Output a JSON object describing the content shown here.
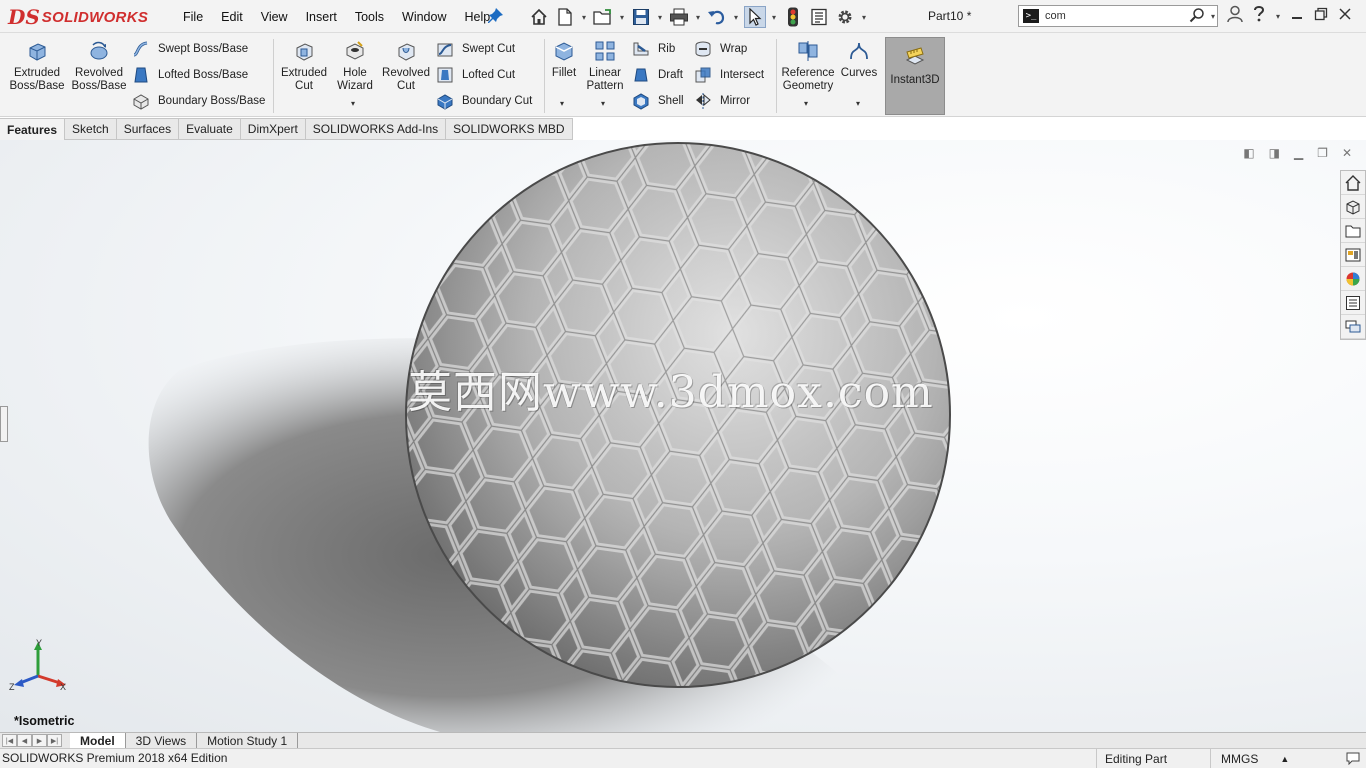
{
  "app": {
    "brand_mark": "DS",
    "brand_name": "SOLIDWORKS",
    "doc_title": "Part10 *"
  },
  "menu": [
    "File",
    "Edit",
    "View",
    "Insert",
    "Tools",
    "Window",
    "Help"
  ],
  "search": {
    "value": "com"
  },
  "commands": {
    "extruded_boss": "Extruded\nBoss/Base",
    "revolved_boss": "Revolved\nBoss/Base",
    "swept_boss": "Swept Boss/Base",
    "lofted_boss": "Lofted Boss/Base",
    "boundary_boss": "Boundary Boss/Base",
    "extruded_cut": "Extruded\nCut",
    "hole_wizard": "Hole\nWizard",
    "revolved_cut": "Revolved\nCut",
    "swept_cut": "Swept Cut",
    "lofted_cut": "Lofted Cut",
    "boundary_cut": "Boundary Cut",
    "fillet": "Fillet",
    "linear_pattern": "Linear\nPattern",
    "rib": "Rib",
    "draft": "Draft",
    "shell": "Shell",
    "wrap": "Wrap",
    "intersect": "Intersect",
    "mirror": "Mirror",
    "reference_geometry": "Reference\nGeometry",
    "curves": "Curves",
    "instant3d": "Instant3D"
  },
  "tabs": [
    "Features",
    "Sketch",
    "Surfaces",
    "Evaluate",
    "DimXpert",
    "SOLIDWORKS Add-Ins",
    "SOLIDWORKS MBD"
  ],
  "viewport": {
    "view_name": "*Isometric",
    "watermark": "莫西网www.3dmox.com",
    "axis_labels": {
      "x": "X",
      "y": "Y",
      "z": "Z"
    }
  },
  "model_tabs": [
    "Model",
    "3D Views",
    "Motion Study 1"
  ],
  "status": {
    "product": "SOLIDWORKS Premium 2018 x64 Edition",
    "mode": "Editing Part",
    "units": "MMGS",
    "units_arrow": "▲"
  },
  "colors": {
    "brand": "#d02e2e",
    "toolbar_bg": "#f3f3f3",
    "icon_blue": "#3a78c2"
  }
}
